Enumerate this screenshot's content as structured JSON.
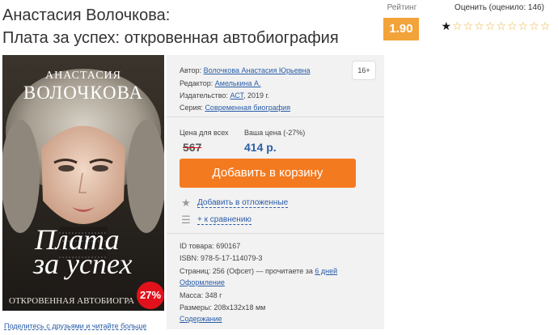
{
  "title": {
    "line1": "Анастасия Волочкова:",
    "line2": "Плата за успех: откровенная автобиография"
  },
  "rating": {
    "label": "Рейтинг",
    "value": "1.90"
  },
  "rate": {
    "label": "Оценить (оценило: 146)",
    "filled": 1,
    "total": 10
  },
  "cover": {
    "author_first": "АНАСТАСИЯ",
    "author_last": "ВОЛОЧКОВА",
    "title_line1": "Плата",
    "title_line2": "за успех",
    "subtitle": "ОТКРОВЕННАЯ АВТОБИОГРА",
    "discount": "27%"
  },
  "details": {
    "author_label": "Автор:",
    "author": "Волочкова Анастасия Юрьевна",
    "editor_label": "Редактор:",
    "editor": "Амелькина А.",
    "publisher_label": "Издательство:",
    "publisher": "АСТ",
    "year": ", 2019 г.",
    "series_label": "Серия:",
    "series": "Современная биография",
    "age": "16+"
  },
  "price": {
    "all_label": "Цена для всех",
    "your_label": "Ваша цена (-27%)",
    "old": "567",
    "new": "414 р."
  },
  "actions": {
    "cart": "Добавить в корзину",
    "wishlist": "Добавить в отложенные",
    "compare": "+ к сравнению"
  },
  "meta": {
    "id_label": "ID товара:",
    "id": "690167",
    "isbn_label": "ISBN:",
    "isbn": "978-5-17-114079-3",
    "pages_text": "Страниц: 256 (Офсет) — прочитаете за",
    "pages_link": "6 дней",
    "design_link": "Оформление",
    "mass": "Масса: 348 г",
    "size": "Размеры: 208x132x18 мм",
    "contents_link": "Содержание"
  },
  "share": "Поделитесь с друзьями и читайте больше"
}
